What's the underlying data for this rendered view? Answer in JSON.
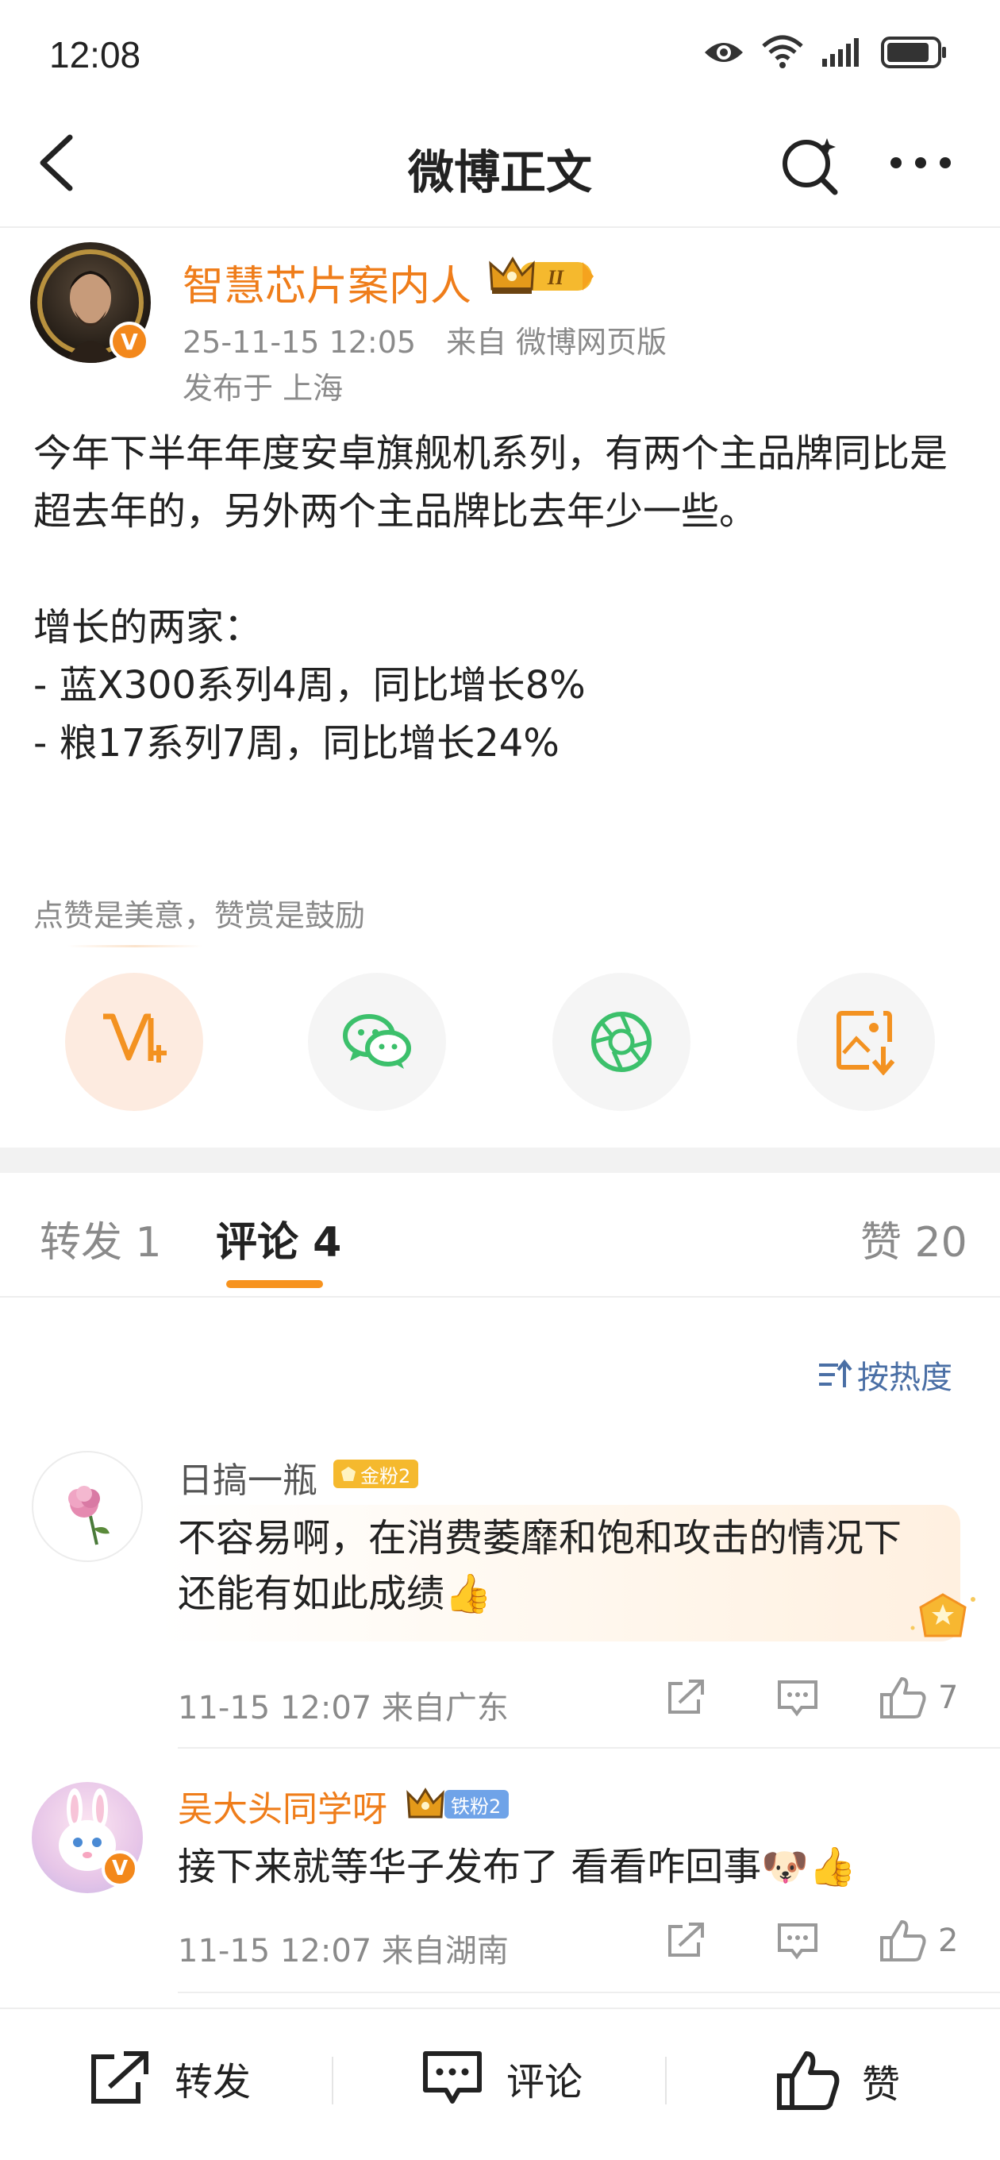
{
  "status_bar": {
    "time": "12:08"
  },
  "header": {
    "title": "微博正文"
  },
  "post": {
    "author": "智慧芯片案内人",
    "author_level": "II",
    "time_source": "25-11-15 12:05　来自 微博网页版",
    "location": "发布于 上海",
    "body": "今年下半年年度安卓旗舰机系列，有两个主品牌同比是超去年的，另外两个主品牌比去年少一些。\n\n增长的两家：\n- 蓝X300系列4周，同比增长8%\n- 粮17系列7周，同比增长24%",
    "reward_hint": "点赞是美意，赞赏是鼓励"
  },
  "tabs": {
    "repost": "转发 1",
    "comment": "评论 4",
    "like": "赞 20"
  },
  "sort_label": "按热度",
  "comments": [
    {
      "name": "日搞一瓶",
      "badge": "金粉2",
      "text": "不容易啊，在消费萎靡和饱和攻击的情况下还能有如此成绩👍",
      "meta": "11-15 12:07  来自广东",
      "likes": "7"
    },
    {
      "name": "吴大头同学呀",
      "badge": "铁粉2",
      "text": "接下来就等华子发布了 看看咋回事🐶👍",
      "meta": "11-15 12:07  来自湖南",
      "likes": "2"
    }
  ],
  "bottom_bar": {
    "repost": "转发",
    "comment": "评论",
    "like": "赞"
  },
  "colors": {
    "accent": "#f7931e",
    "author_name": "#ef7d1a",
    "link_blue": "#4a6fa5",
    "secondary_text": "#8a8a8a"
  },
  "icons": [
    "back-icon",
    "search-icon",
    "more-icon",
    "reward-icon",
    "wechat-icon",
    "moments-icon",
    "save-image-icon",
    "sort-icon",
    "share-icon",
    "comment-icon",
    "like-icon"
  ]
}
